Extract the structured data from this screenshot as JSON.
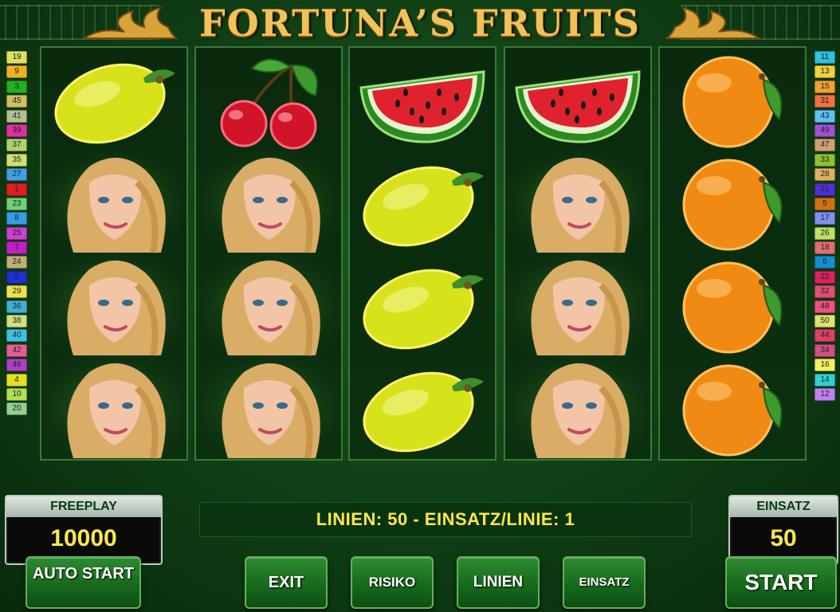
{
  "game": {
    "title": "FORTUNA’S FRUITS"
  },
  "paylines": {
    "left": [
      "19",
      "9",
      "3",
      "45",
      "41",
      "39",
      "37",
      "35",
      "27",
      "1",
      "23",
      "8",
      "25",
      "7",
      "24",
      "2",
      "29",
      "36",
      "38",
      "40",
      "42",
      "46",
      "4",
      "10",
      "20"
    ],
    "right": [
      "11",
      "13",
      "15",
      "31",
      "43",
      "49",
      "47",
      "33",
      "28",
      "21",
      "5",
      "17",
      "26",
      "18",
      "6",
      "22",
      "32",
      "48",
      "50",
      "44",
      "34",
      "16",
      "14",
      "12"
    ],
    "colors": {
      "1": "#e02020",
      "2": "#2030d0",
      "3": "#20b020",
      "4": "#e0e020",
      "5": "#d07010",
      "6": "#1090d0",
      "7": "#c020c0",
      "8": "#30a0e0",
      "9": "#f0b020",
      "10": "#b0e050",
      "11": "#30c0e0",
      "12": "#c080f0",
      "13": "#f0d040",
      "14": "#30d0d0",
      "15": "#f0a030",
      "16": "#f0f060",
      "17": "#8090f0",
      "18": "#e07070",
      "19": "#e0e060",
      "20": "#90d090",
      "21": "#5030d0",
      "22": "#e02060",
      "23": "#70d070",
      "24": "#c0b070",
      "25": "#d040d0",
      "26": "#c0e060",
      "27": "#40a0e0",
      "28": "#e0b060",
      "29": "#f0e050",
      "31": "#f07040",
      "32": "#e05070",
      "33": "#90c030",
      "34": "#d05080",
      "35": "#d0e070",
      "36": "#40b0d0",
      "37": "#b0d070",
      "38": "#d0e080",
      "39": "#e030a0",
      "40": "#40c0e0",
      "41": "#b0c090",
      "42": "#e06090",
      "43": "#60c0f0",
      "44": "#e04060",
      "45": "#d0c060",
      "46": "#b040c0",
      "47": "#d0a070",
      "48": "#f05080",
      "49": "#a050d0",
      "50": "#e0e070"
    }
  },
  "reels": [
    [
      "lemon",
      "woman",
      "woman",
      "woman"
    ],
    [
      "cherry",
      "woman",
      "woman",
      "woman"
    ],
    [
      "watermelon",
      "lemon",
      "lemon",
      "lemon"
    ],
    [
      "watermelon",
      "woman",
      "woman",
      "woman"
    ],
    [
      "orange",
      "orange",
      "orange",
      "orange"
    ]
  ],
  "freeplay": {
    "label": "FREEPLAY",
    "value": "10000"
  },
  "status": {
    "text": "LINIEN: 50  -  EINSATZ/LINIE: 1"
  },
  "bet": {
    "label": "EINSATZ",
    "value": "50"
  },
  "buttons": {
    "auto_start": "AUTO START",
    "exit": "EXIT",
    "risiko": "RISIKO",
    "linien": "LINIEN",
    "einsatz": "EINSATZ",
    "start": "START"
  }
}
